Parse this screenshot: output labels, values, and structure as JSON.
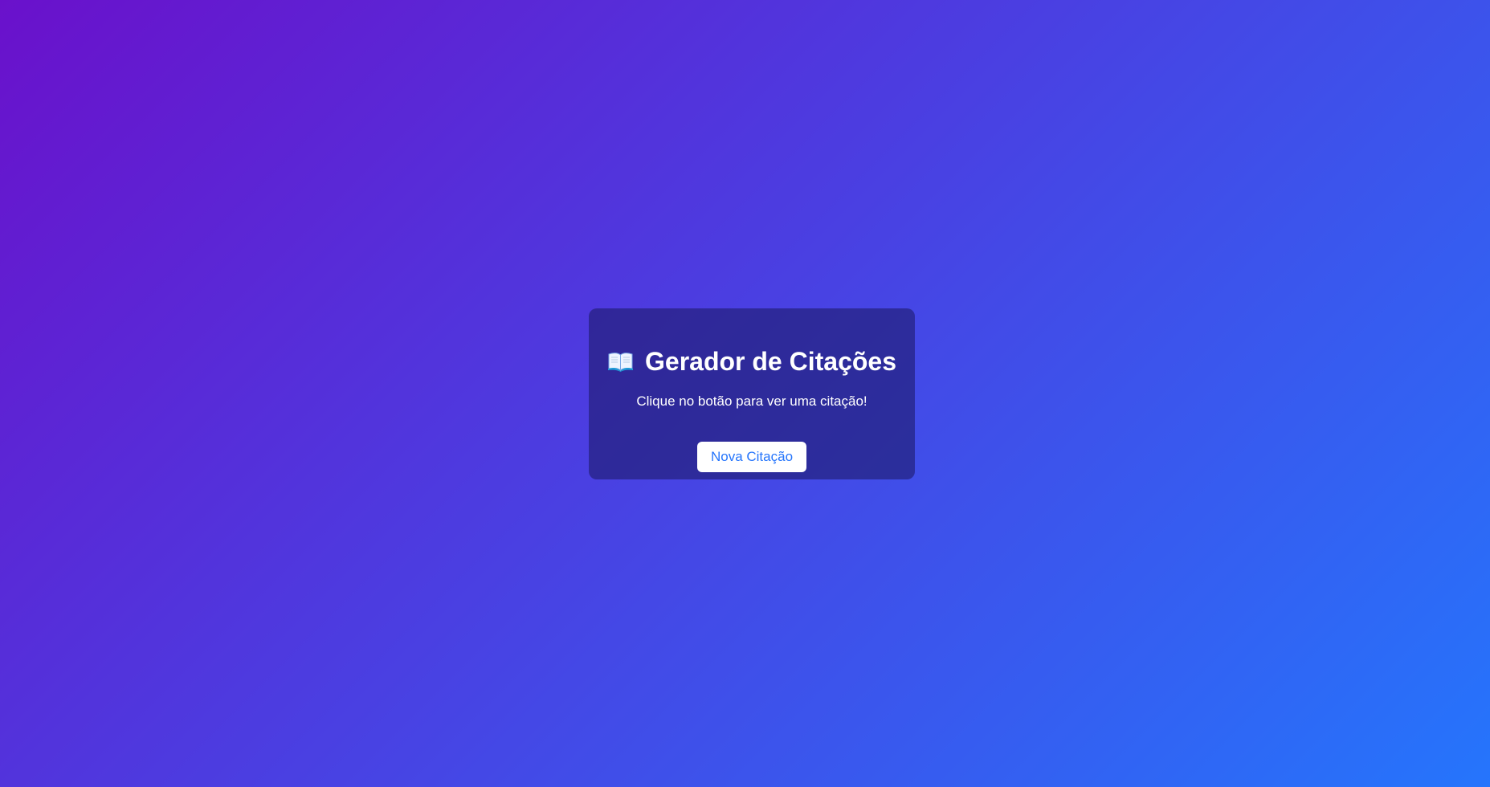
{
  "app": {
    "title": "Gerador de Citações",
    "title_icon": "open-book-icon"
  },
  "quote": {
    "text": "Clique no botão para ver uma citação!"
  },
  "actions": {
    "new_quote_label": "Nova Citação"
  },
  "colors": {
    "background_start": "#6a11cb",
    "background_end": "#2575fc",
    "button_text": "#2575fc",
    "button_background": "#ffffff",
    "text": "#ffffff"
  }
}
